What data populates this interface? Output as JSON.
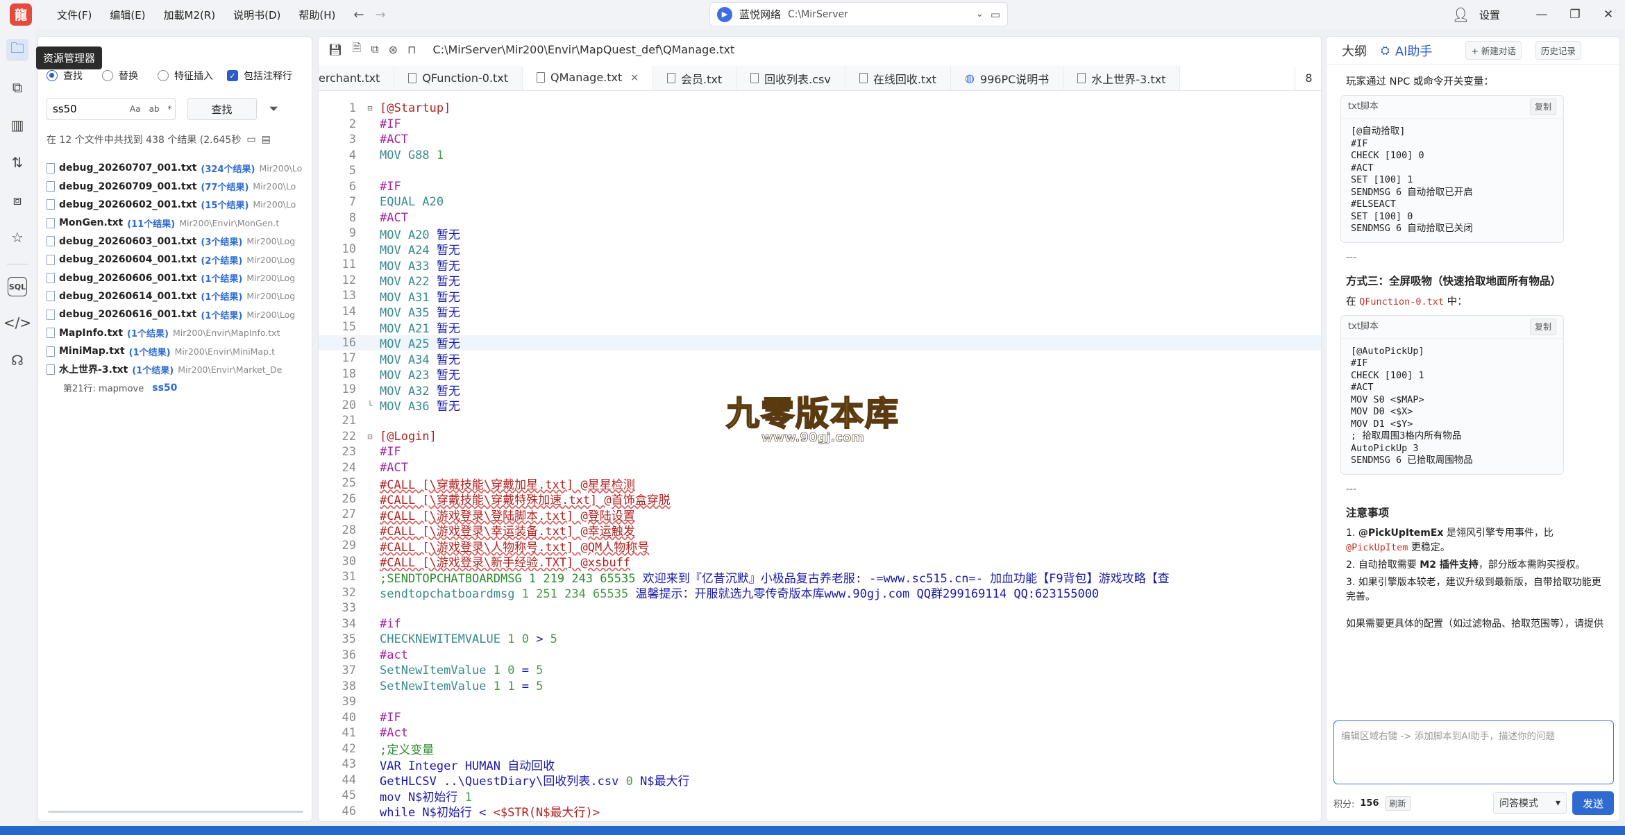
{
  "titlebar": {
    "logo": "龍",
    "menus": [
      "文件(F)",
      "编辑(E)",
      "加載M2(R)",
      "说明书(D)",
      "帮助(H)"
    ],
    "back_icon": "arrow-left-icon",
    "forward_icon": "arrow-right-icon",
    "server_name": "蓝悦网络",
    "server_path": "C:\\MirServer",
    "settings_label": "设置"
  },
  "activity": {
    "tooltip": "资源管理器",
    "icons": [
      "explorer-icon",
      "search-replace-icon",
      "analytics-icon",
      "compare-icon",
      "plugin-icon",
      "favorites-icon",
      "sql-icon",
      "code-icon",
      "headset-icon"
    ]
  },
  "explorer": {
    "opt_find": "查找",
    "opt_replace": "替换",
    "opt_feature": "特征插入",
    "opt_comments": "包括注释行",
    "search_value": "ss50",
    "opt_glyphs": [
      "Aa",
      "ab",
      "*"
    ],
    "search_button": "查找",
    "summary": "在 12 个文件中共找到 438 个结果 (2.645秒",
    "results": [
      {
        "name": "debug_20260707_001.txt",
        "count": "(324个结果)",
        "path": "Mir200\\Lo"
      },
      {
        "name": "debug_20260709_001.txt",
        "count": "(77个结果)",
        "path": "Mir200\\Lo"
      },
      {
        "name": "debug_20260602_001.txt",
        "count": "(15个结果)",
        "path": "Mir200\\Lo"
      },
      {
        "name": "MonGen.txt",
        "count": "(11个结果)",
        "path": "Mir200\\Envir\\MonGen.t"
      },
      {
        "name": "debug_20260603_001.txt",
        "count": "(3个结果)",
        "path": "Mir200\\Log"
      },
      {
        "name": "debug_20260604_001.txt",
        "count": "(2个结果)",
        "path": "Mir200\\Log"
      },
      {
        "name": "debug_20260606_001.txt",
        "count": "(1个结果)",
        "path": "Mir200\\Log"
      },
      {
        "name": "debug_20260614_001.txt",
        "count": "(1个结果)",
        "path": "Mir200\\Log"
      },
      {
        "name": "debug_20260616_001.txt",
        "count": "(1个结果)",
        "path": "Mir200\\Log"
      },
      {
        "name": "MapInfo.txt",
        "count": "(1个结果)",
        "path": "Mir200\\Envir\\MapInfo.txt"
      },
      {
        "name": "MiniMap.txt",
        "count": "(1个结果)",
        "path": "Mir200\\Envir\\MiniMap.t"
      },
      {
        "name": "水上世界-3.txt",
        "count": "(1个结果)",
        "path": "Mir200\\Envir\\Market_De"
      }
    ],
    "match_line": "第21行: mapmove",
    "match_highlight": "ss50"
  },
  "editor": {
    "file_path": "C:\\MirServer\\Mir200\\Envir\\MapQuest_def\\QManage.txt",
    "tabs": [
      {
        "label": "erchant.txt",
        "icon": ""
      },
      {
        "label": "QFunction-0.txt",
        "icon": "file-icon"
      },
      {
        "label": "QManage.txt",
        "icon": "file-icon",
        "active": true
      },
      {
        "label": "会员.txt",
        "icon": "file-icon"
      },
      {
        "label": "回收列表.csv",
        "icon": "file-icon"
      },
      {
        "label": "在线回收.txt",
        "icon": "file-icon"
      },
      {
        "label": "996PC说明书",
        "icon": "globe-icon"
      },
      {
        "label": "水上世界-3.txt",
        "icon": "file-icon"
      }
    ],
    "tab_overflow_count": "8",
    "close_glyph": "×",
    "lines": [
      {
        "n": "1",
        "fold": "⊟",
        "segs": [
          [
            "k-lbl",
            "[@Startup]"
          ]
        ]
      },
      {
        "n": "2",
        "segs": [
          [
            "k-dir",
            "#IF"
          ]
        ]
      },
      {
        "n": "3",
        "segs": [
          [
            "k-dir",
            "#ACT"
          ]
        ]
      },
      {
        "n": "4",
        "segs": [
          [
            "k-cmd",
            "MOV G88 "
          ],
          [
            "k-num",
            "1"
          ]
        ]
      },
      {
        "n": "5",
        "segs": []
      },
      {
        "n": "6",
        "segs": [
          [
            "k-dir",
            "#IF"
          ]
        ]
      },
      {
        "n": "7",
        "segs": [
          [
            "k-cmd",
            "EQUAL A20"
          ]
        ]
      },
      {
        "n": "8",
        "segs": [
          [
            "k-dir",
            "#ACT"
          ]
        ]
      },
      {
        "n": "9",
        "segs": [
          [
            "k-cmd",
            "MOV A20 "
          ],
          [
            "k-txt",
            "暂无"
          ]
        ]
      },
      {
        "n": "10",
        "segs": [
          [
            "k-cmd",
            "MOV A24 "
          ],
          [
            "k-txt",
            "暂无"
          ]
        ]
      },
      {
        "n": "11",
        "segs": [
          [
            "k-cmd",
            "MOV A33 "
          ],
          [
            "k-txt",
            "暂无"
          ]
        ]
      },
      {
        "n": "12",
        "segs": [
          [
            "k-cmd",
            "MOV A22 "
          ],
          [
            "k-txt",
            "暂无"
          ]
        ]
      },
      {
        "n": "13",
        "segs": [
          [
            "k-cmd",
            "MOV A31 "
          ],
          [
            "k-txt",
            "暂无"
          ]
        ]
      },
      {
        "n": "14",
        "segs": [
          [
            "k-cmd",
            "MOV A35 "
          ],
          [
            "k-txt",
            "暂无"
          ]
        ]
      },
      {
        "n": "15",
        "segs": [
          [
            "k-cmd",
            "MOV A21 "
          ],
          [
            "k-txt",
            "暂无"
          ]
        ]
      },
      {
        "n": "16",
        "hl": true,
        "segs": [
          [
            "k-cmd",
            "MOV A25 "
          ],
          [
            "k-txt",
            "暂无"
          ]
        ]
      },
      {
        "n": "17",
        "segs": [
          [
            "k-cmd",
            "MOV A34 "
          ],
          [
            "k-txt",
            "暂无"
          ]
        ]
      },
      {
        "n": "18",
        "segs": [
          [
            "k-cmd",
            "MOV A23 "
          ],
          [
            "k-txt",
            "暂无"
          ]
        ]
      },
      {
        "n": "19",
        "segs": [
          [
            "k-cmd",
            "MOV A32 "
          ],
          [
            "k-txt",
            "暂无"
          ]
        ]
      },
      {
        "n": "20",
        "fold": "└",
        "segs": [
          [
            "k-cmd",
            "MOV A36 "
          ],
          [
            "k-txt",
            "暂无"
          ]
        ]
      },
      {
        "n": "21",
        "segs": []
      },
      {
        "n": "22",
        "fold": "⊟",
        "segs": [
          [
            "k-lbl",
            "[@Login]"
          ]
        ]
      },
      {
        "n": "23",
        "segs": [
          [
            "k-dir",
            "#IF"
          ]
        ]
      },
      {
        "n": "24",
        "segs": [
          [
            "k-dir",
            "#ACT"
          ]
        ]
      },
      {
        "n": "25",
        "segs": [
          [
            "k-call",
            "#CALL [\\穿戴技能\\穿戴加星.txt] @星星检测"
          ]
        ]
      },
      {
        "n": "26",
        "segs": [
          [
            "k-call",
            "#CALL [\\穿戴技能\\穿戴特殊加速.txt] @首饰盒穿脱"
          ]
        ]
      },
      {
        "n": "27",
        "segs": [
          [
            "k-call",
            "#CALL [\\游戏登录\\登陆脚本.txt] @登陆设置"
          ]
        ]
      },
      {
        "n": "28",
        "segs": [
          [
            "k-call",
            "#CALL [\\游戏登录\\幸运装备.txt] @幸运触发"
          ]
        ]
      },
      {
        "n": "29",
        "segs": [
          [
            "k-call",
            "#CALL [\\游戏登录\\人物称号.txt] @QM人物称号"
          ]
        ]
      },
      {
        "n": "30",
        "segs": [
          [
            "k-call",
            "#CALL [\\游戏登录\\新手经验.TXT] @xsbuff"
          ]
        ]
      },
      {
        "n": "31",
        "segs": [
          [
            "k-cmt",
            ";SENDTOPCHATBOARDMSG 1 219 243 65535 "
          ],
          [
            "k-txt",
            "欢迎来到『亿昔沉默』小极品复古养老服: -=www.sc515.cn=- 加血功能【F9背包】游戏攻略【查"
          ]
        ]
      },
      {
        "n": "32",
        "segs": [
          [
            "k-cmd",
            "sendtopchatboardmsg "
          ],
          [
            "k-num",
            "1 251 234 65535 "
          ],
          [
            "k-txt",
            "温馨提示：开服就选九零传奇版本库www.90gj.com QQ群299169114 QQ:623155000"
          ]
        ]
      },
      {
        "n": "33",
        "segs": []
      },
      {
        "n": "34",
        "segs": [
          [
            "k-dir",
            "#if"
          ]
        ]
      },
      {
        "n": "35",
        "segs": [
          [
            "k-cmd",
            "CHECKNEWITEMVALUE "
          ],
          [
            "k-num",
            "1 0 "
          ],
          [
            "k-txt",
            "> "
          ],
          [
            "k-num",
            "5"
          ]
        ]
      },
      {
        "n": "36",
        "segs": [
          [
            "k-dir",
            "#act"
          ]
        ]
      },
      {
        "n": "37",
        "segs": [
          [
            "k-cmd",
            "SetNewItemValue "
          ],
          [
            "k-num",
            "1 0 "
          ],
          [
            "k-txt",
            "= "
          ],
          [
            "k-num",
            "5"
          ]
        ]
      },
      {
        "n": "38",
        "segs": [
          [
            "k-cmd",
            "SetNewItemValue "
          ],
          [
            "k-num",
            "1 1 "
          ],
          [
            "k-txt",
            "= "
          ],
          [
            "k-num",
            "5"
          ]
        ]
      },
      {
        "n": "39",
        "segs": []
      },
      {
        "n": "40",
        "segs": [
          [
            "k-dir",
            "#IF"
          ]
        ]
      },
      {
        "n": "41",
        "segs": [
          [
            "k-dir",
            "#Act"
          ]
        ]
      },
      {
        "n": "42",
        "segs": [
          [
            "k-cmt",
            ";定义变量"
          ]
        ]
      },
      {
        "n": "43",
        "segs": [
          [
            "k-txt",
            "VAR Integer HUMAN 自动回收"
          ]
        ]
      },
      {
        "n": "44",
        "segs": [
          [
            "k-txt",
            "GetHLCSV ..\\QuestDiary\\回收列表.csv "
          ],
          [
            "k-num",
            "0 "
          ],
          [
            "k-txt",
            "N$最大行"
          ]
        ]
      },
      {
        "n": "45",
        "segs": [
          [
            "k-txt",
            "mov N$初始行 "
          ],
          [
            "k-num",
            "1"
          ]
        ]
      },
      {
        "n": "46",
        "segs": [
          [
            "k-txt",
            "while N$初始行 < "
          ],
          [
            "k-lbl",
            "<$STR(N$最大行)>"
          ]
        ]
      }
    ]
  },
  "watermark": {
    "title": "九零版本库",
    "url": "www.90gj.com"
  },
  "ai_panel": {
    "tab_outline": "大纲",
    "tab_ai": "AI助手",
    "new_chat": "+ 新建对话",
    "history": "历史记录",
    "intro": "玩家通过 NPC 或命令开关变量：",
    "code1_lang": "txt脚本",
    "copy_label": "复制",
    "code1": "[@自动拾取]\n#IF\nCHECK [100] 0\n#ACT\nSET [100] 1\nSENDMSG 6 自动拾取已开启\n#ELSEACT\nSET [100] 0\nSENDMSG 6 自动拾取已关闭",
    "hr": "---",
    "method3_title": "方式三：全屏吸物（快速拾取地面所有物品）",
    "in_prefix": "在 ",
    "in_file": "QFunction-0.txt",
    "in_suffix": " 中：",
    "code2_lang": "txt脚本",
    "code2": "[@AutoPickUp]\n#IF\nCHECK [100] 1\n#ACT\nMOV S0 <$MAP>\nMOV D0 <$X>\nMOV D1 <$Y>\n; 拾取周围3格内所有物品\nAutoPickUp 3\nSENDMSG 6 已拾取周围物品",
    "hr2": "---",
    "notes_title": "注意事项",
    "note1_a": "1. ",
    "note1_b": "@PickUpItemEx",
    "note1_c": " 是翎风引擎专用事件，比 ",
    "note1_d": "@PickUpItem",
    "note1_e": " 更稳定。",
    "note2_a": "2. 自动拾取需要 ",
    "note2_b": "M2 插件支持",
    "note2_c": "，部分版本需购买授权。",
    "note3": "3. 如果引擎版本较老，建议升级到最新版，自带拾取功能更完善。",
    "more": "如果需要更具体的配置（如过滤物品、拾取范围等），请提供你的引擎版本号。",
    "input_placeholder": "编辑区域右键 -> 添加脚本到AI助手，描述你的问题",
    "score_label": "积分:",
    "score_value": "156",
    "refresh_label": "刷新",
    "mode": "问答模式",
    "send": "发送"
  }
}
